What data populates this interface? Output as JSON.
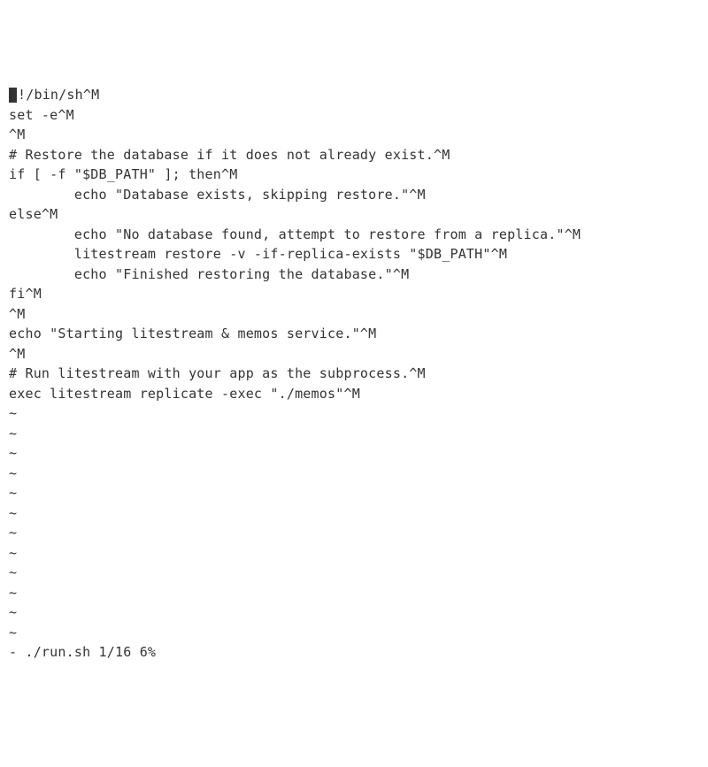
{
  "editor": {
    "lines": [
      "!/bin/sh^M",
      "set -e^M",
      "^M",
      "# Restore the database if it does not already exist.^M",
      "if [ -f \"$DB_PATH\" ]; then^M",
      "        echo \"Database exists, skipping restore.\"^M",
      "else^M",
      "        echo \"No database found, attempt to restore from a replica.\"^M",
      "        litestream restore -v -if-replica-exists \"$DB_PATH\"^M",
      "        echo \"Finished restoring the database.\"^M",
      "fi^M",
      "^M",
      "echo \"Starting litestream & memos service.\"^M",
      "^M",
      "# Run litestream with your app as the subprocess.^M",
      "exec litestream replicate -exec \"./memos\"^M"
    ],
    "tilde_count": 12,
    "tilde": "~",
    "status": "- ./run.sh 1/16 6%"
  }
}
